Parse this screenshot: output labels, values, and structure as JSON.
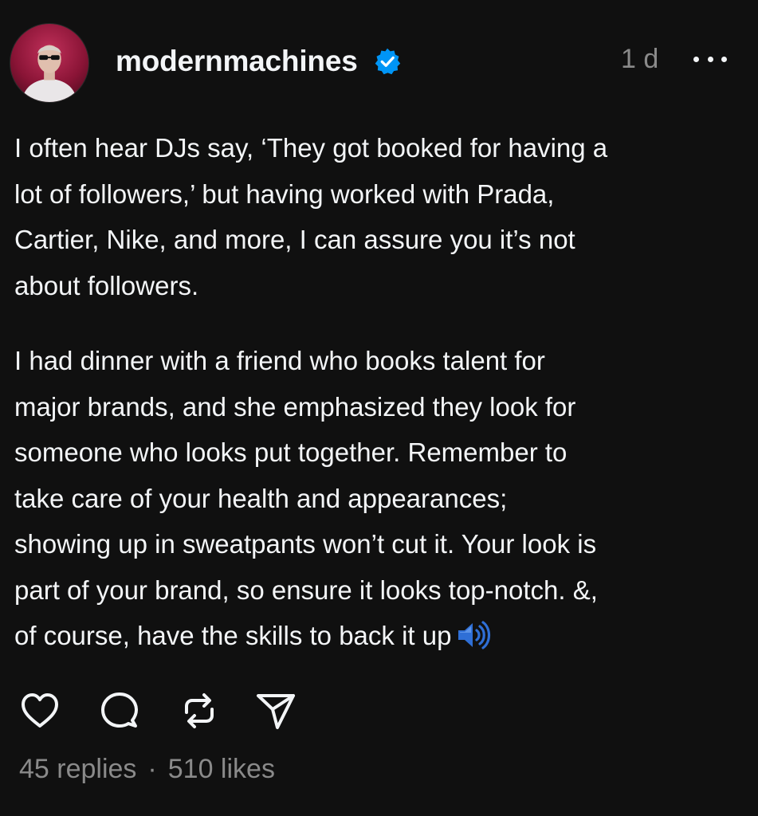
{
  "post": {
    "username": "modernmachines",
    "timestamp": "1 d",
    "paragraphs": [
      "I often hear DJs say, ‘They got booked for having a\nlot of followers,’ but having worked with Prada,\nCartier, Nike, and more, I can assure you it’s not\nabout followers.",
      "I had dinner with a friend who books talent for\nmajor brands, and she emphasized they look for\nsomeone who looks put together. Remember to\ntake care of your health and appearances;\nshowing up in sweatpants won’t cut it. Your look is\npart of your brand, so ensure it looks top-notch. &,\nof course, have the skills to back it up"
    ],
    "emoji": "speaker-loud-icon",
    "replies": "45 replies",
    "separator": "·",
    "likes": "510 likes"
  },
  "icons": {
    "verified": "verified-badge-icon",
    "more": "more-options-icon",
    "like": "heart-icon",
    "reply": "comment-icon",
    "repost": "repost-icon",
    "share": "send-icon"
  },
  "colors": {
    "background": "#101010",
    "text": "#f3f5f7",
    "secondary": "#8a8a8a",
    "verified": "#0095f6"
  }
}
